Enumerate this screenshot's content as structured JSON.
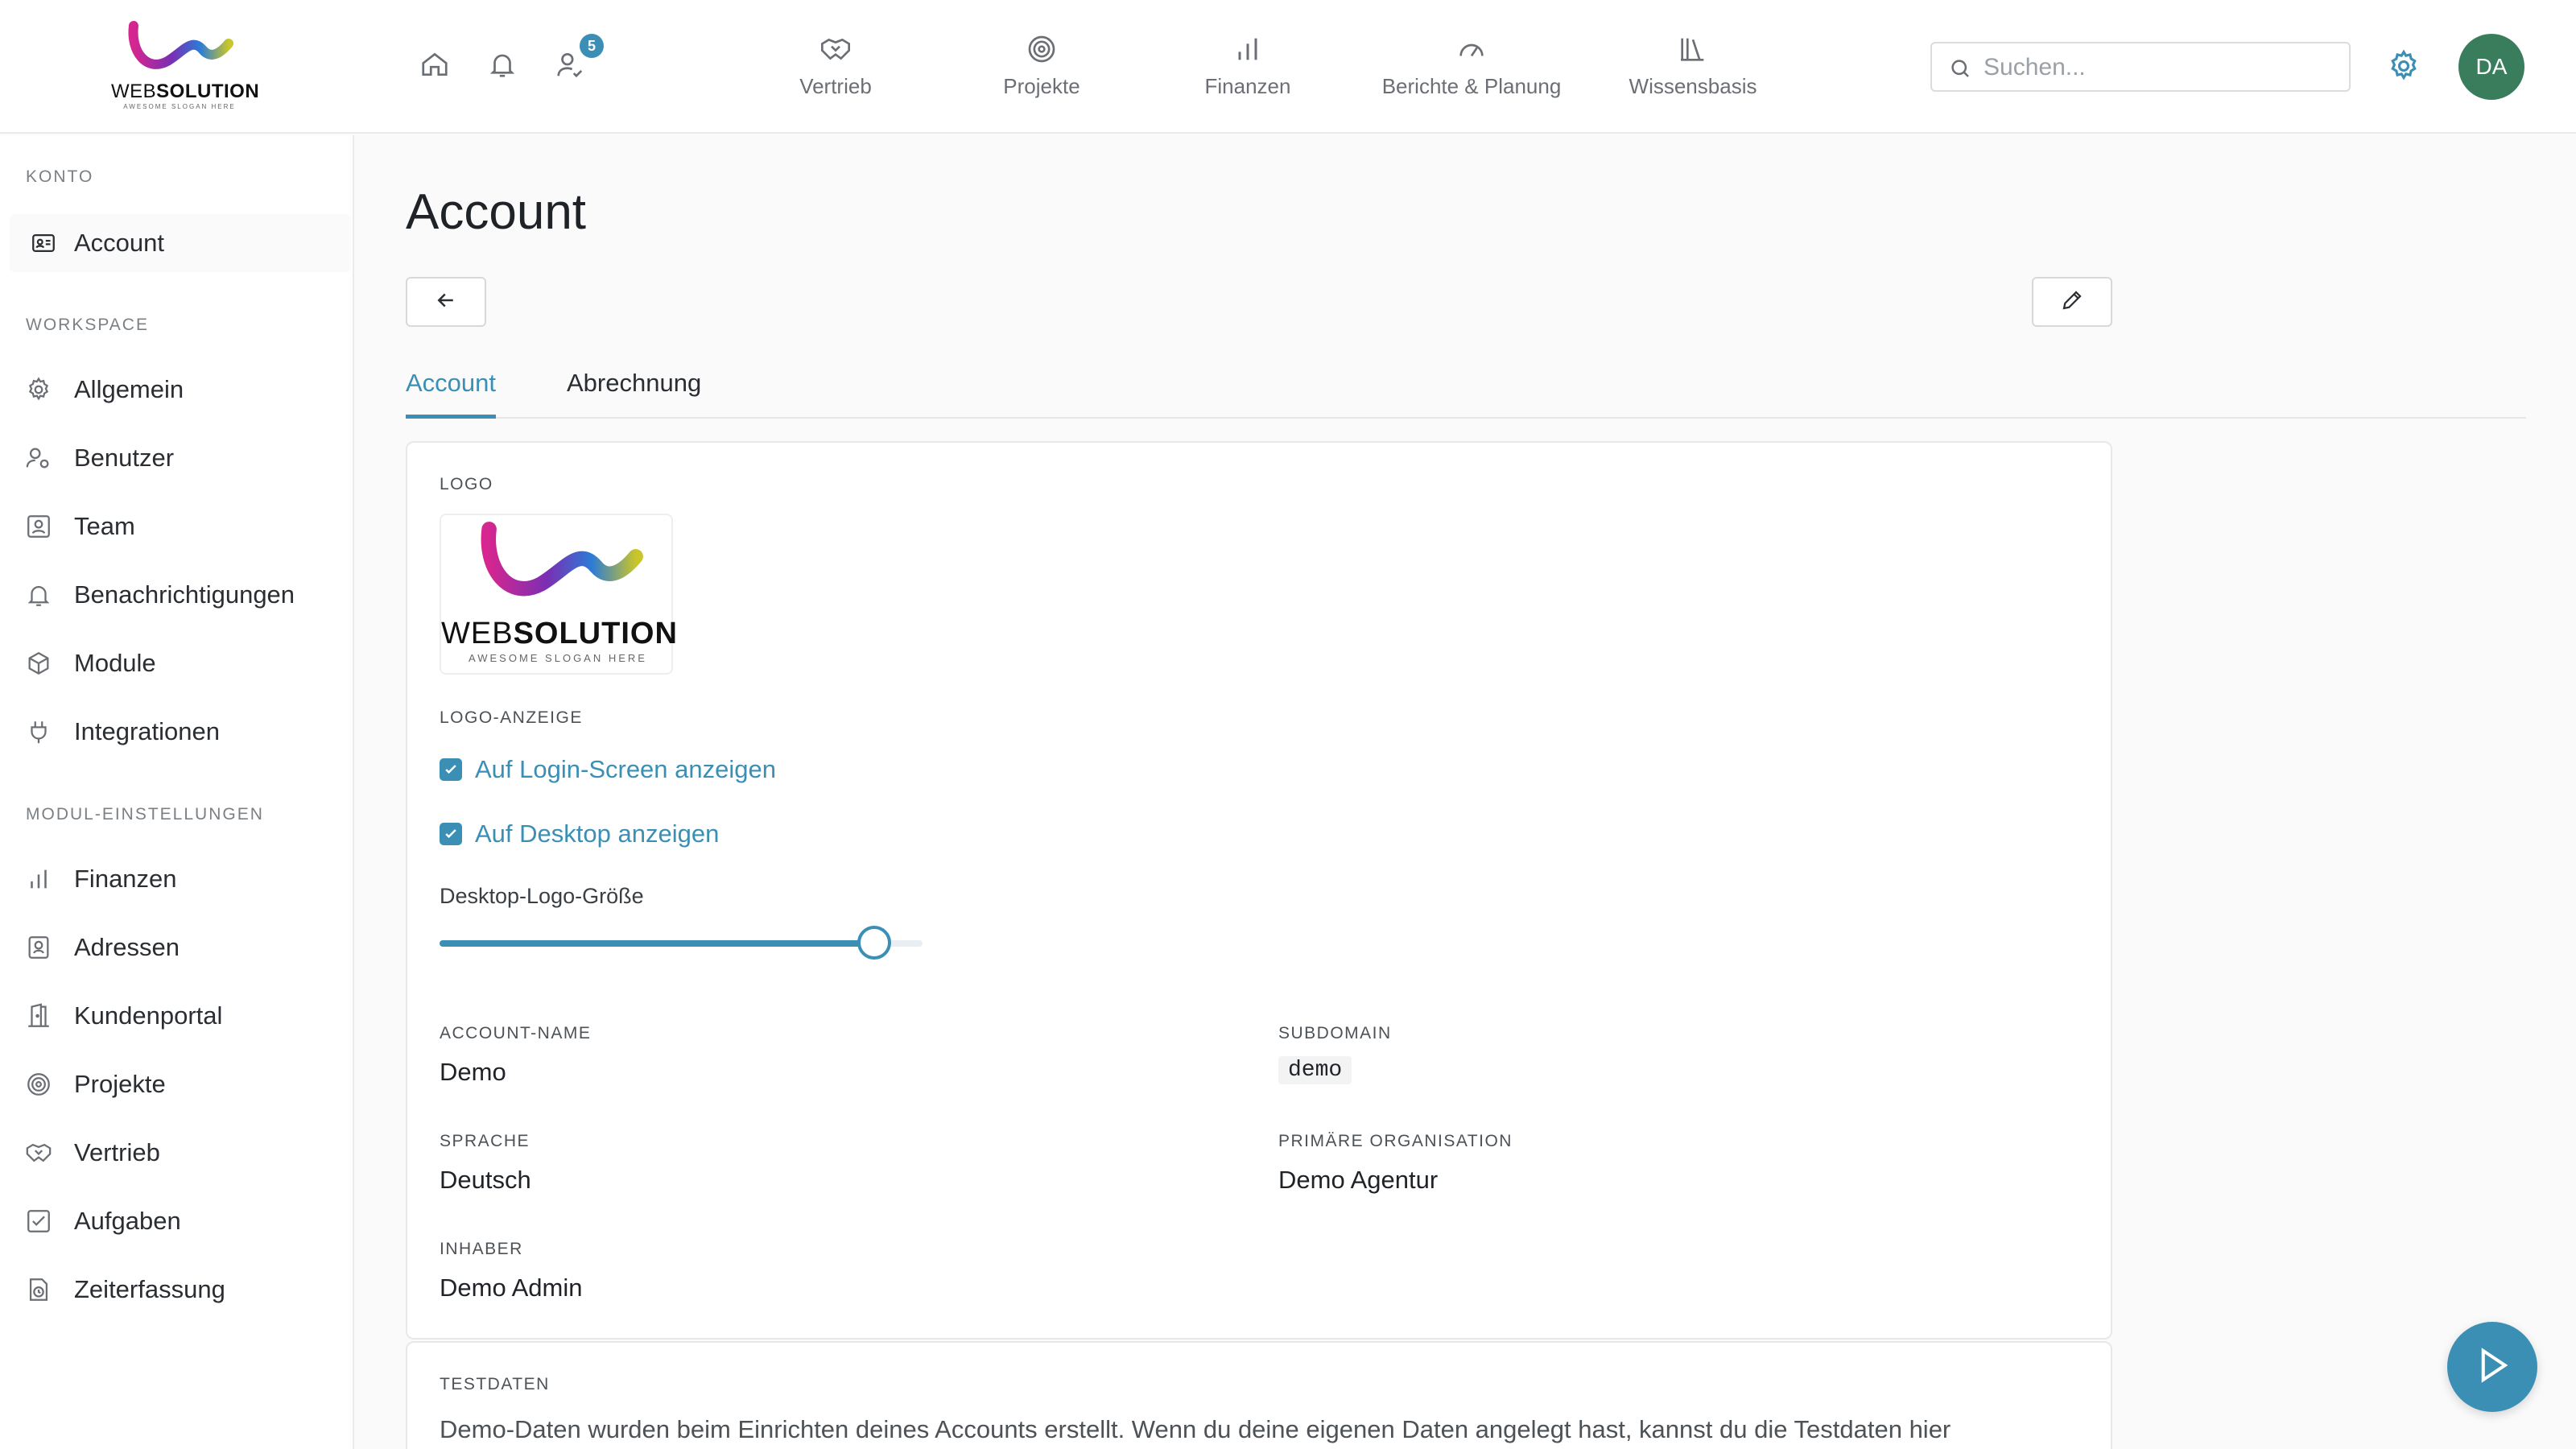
{
  "brand": {
    "name_light": "WEB",
    "name_bold": "SOLUTION",
    "slogan": "AWESOME SLOGAN HERE"
  },
  "topbar": {
    "notification_count": "5",
    "nav": [
      {
        "label": "Vertrieb",
        "icon": "handshake-icon"
      },
      {
        "label": "Projekte",
        "icon": "target-icon"
      },
      {
        "label": "Finanzen",
        "icon": "bar-chart-icon"
      },
      {
        "label": "Berichte & Planung",
        "icon": "gauge-icon"
      },
      {
        "label": "Wissensbasis",
        "icon": "library-icon"
      }
    ],
    "search_placeholder": "Suchen...",
    "avatar_initials": "DA"
  },
  "sidebar": {
    "section_konto": "KONTO",
    "konto_items": [
      {
        "label": "Account",
        "icon": "id-card-icon"
      }
    ],
    "section_workspace": "WORKSPACE",
    "workspace_items": [
      {
        "label": "Allgemein",
        "icon": "gear-icon"
      },
      {
        "label": "Benutzer",
        "icon": "user-gear-icon"
      },
      {
        "label": "Team",
        "icon": "team-icon"
      },
      {
        "label": "Benachrichtigungen",
        "icon": "bell-icon"
      },
      {
        "label": "Module",
        "icon": "cube-icon"
      },
      {
        "label": "Integrationen",
        "icon": "plug-icon"
      }
    ],
    "section_module": "MODUL-EINSTELLUNGEN",
    "module_items": [
      {
        "label": "Finanzen",
        "icon": "bar-chart-icon"
      },
      {
        "label": "Adressen",
        "icon": "contact-icon"
      },
      {
        "label": "Kundenportal",
        "icon": "door-icon"
      },
      {
        "label": "Projekte",
        "icon": "target-icon"
      },
      {
        "label": "Vertrieb",
        "icon": "handshake-icon"
      },
      {
        "label": "Aufgaben",
        "icon": "checkbox-icon"
      },
      {
        "label": "Zeiterfassung",
        "icon": "timer-icon"
      }
    ]
  },
  "page": {
    "title": "Account",
    "tabs": [
      "Account",
      "Abrechnung"
    ]
  },
  "account_card": {
    "logo_label": "LOGO",
    "logo_display_label": "LOGO-ANZEIGE",
    "checkbox_login": "Auf Login-Screen anzeigen",
    "checkbox_desktop": "Auf Desktop anzeigen",
    "slider_label": "Desktop-Logo-Größe",
    "slider_value_fraction": 0.9,
    "account_name_label": "ACCOUNT-NAME",
    "account_name": "Demo",
    "subdomain_label": "SUBDOMAIN",
    "subdomain": "demo",
    "language_label": "SPRACHE",
    "language": "Deutsch",
    "primary_org_label": "PRIMÄRE ORGANISATION",
    "primary_org": "Demo Agentur",
    "owner_label": "INHABER",
    "owner": "Demo Admin"
  },
  "testdata_card": {
    "label": "TESTDATEN",
    "text": "Demo-Daten wurden beim Einrichten deines Accounts erstellt. Wenn du deine eigenen Daten angelegt hast, kannst du die Testdaten hier"
  },
  "colors": {
    "accent": "#3b8fb5",
    "avatar": "#3a7d5c"
  }
}
